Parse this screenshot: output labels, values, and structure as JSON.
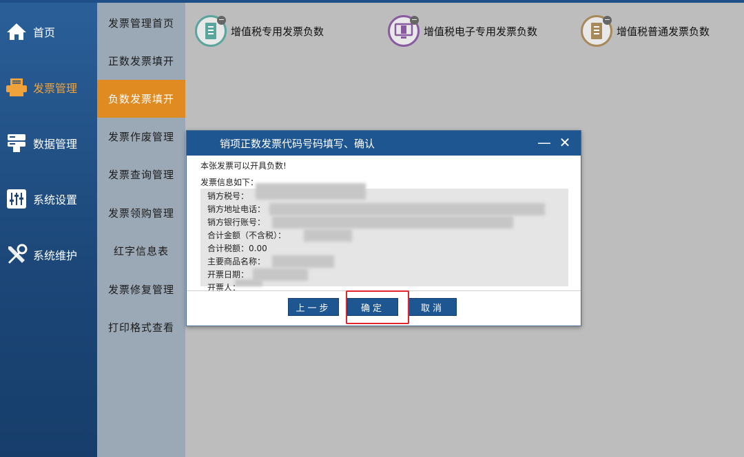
{
  "nav": {
    "items": [
      {
        "label": "首页",
        "icon": "home-icon"
      },
      {
        "label": "发票管理",
        "icon": "printer-icon"
      },
      {
        "label": "数据管理",
        "icon": "database-icon"
      },
      {
        "label": "系统设置",
        "icon": "sliders-icon"
      },
      {
        "label": "系统维护",
        "icon": "tools-icon"
      }
    ],
    "active_index": 1,
    "active_color": "#f0a33a"
  },
  "submenu": {
    "items": [
      "发票管理首页",
      "正数发票填开",
      "负数发票填开",
      "发票作废管理",
      "发票查询管理",
      "发票领购管理",
      "红字信息表",
      "发票修复管理",
      "打印格式查看"
    ],
    "active_index": 2,
    "active_color": "#e08a22"
  },
  "tiles": [
    {
      "label": "增值税专用发票负数",
      "color": "#5aa59c"
    },
    {
      "label": "增值税电子专用发票负数",
      "color": "#8a5aa0"
    },
    {
      "label": "增值税普通发票负数",
      "color": "#a8895a"
    }
  ],
  "dialog": {
    "title": "销项正数发票代码号码填写、确认",
    "minimize": "—",
    "close": "✕",
    "message": "本张发票可以开具负数!",
    "info_title": "发票信息如下：",
    "fields": [
      {
        "label": "销方税号：",
        "value": ""
      },
      {
        "label": "销方地址电话：",
        "value": ""
      },
      {
        "label": "销方银行账号：",
        "value": ""
      },
      {
        "label": "合计金额（不含税）：",
        "value": ""
      },
      {
        "label": "合计税额：",
        "value": "0.00"
      },
      {
        "label": "主要商品名称：",
        "value": ""
      },
      {
        "label": "开票日期：",
        "value": ""
      },
      {
        "label": "开票人：",
        "value": ""
      }
    ],
    "buttons": {
      "prev": "上一步",
      "confirm": "确定",
      "cancel": "取消"
    },
    "title_color": "#1e5692",
    "highlight_color": "#e3232c"
  }
}
